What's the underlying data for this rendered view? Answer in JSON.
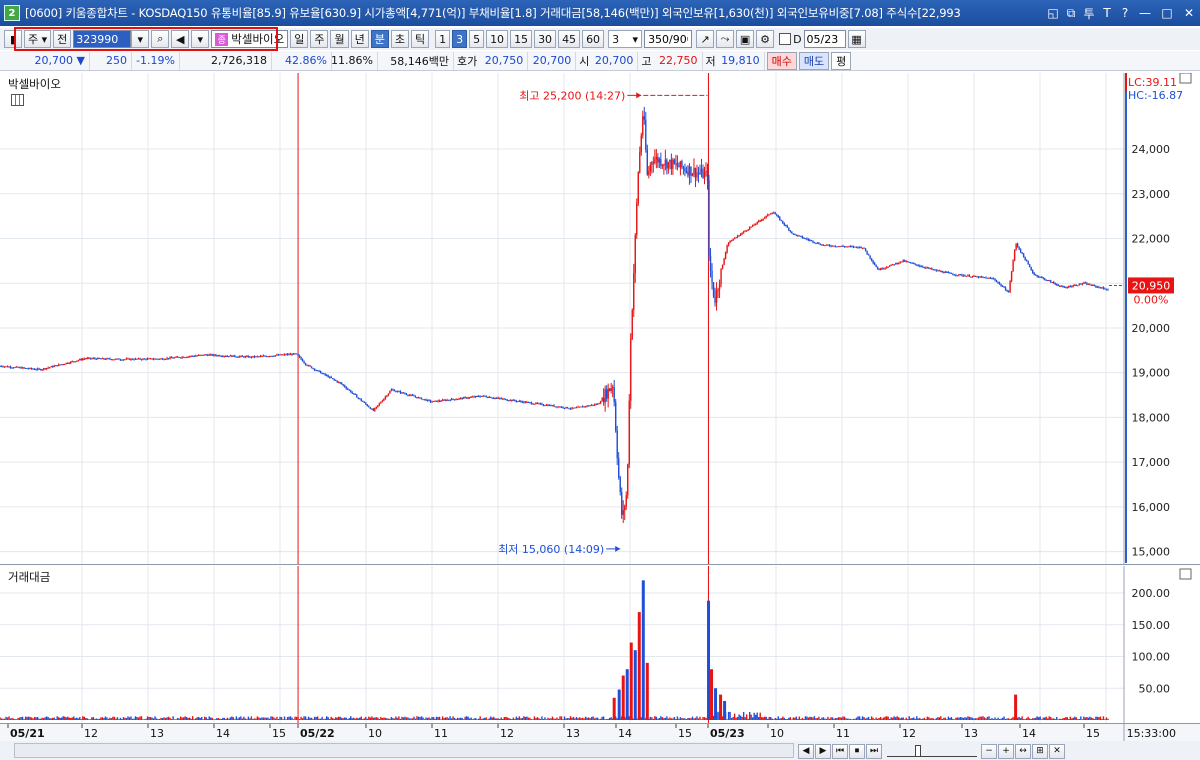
{
  "title_bar": {
    "badge": "2",
    "text": "[0600] 키움종합차트 - KOSDAQ150 유통비율[85.9] 유보율[630.9] 시가총액[4,771(억)] 부채비율[1.8] 거래대금[58,146(백만)] 외국인보유[1,630(천)] 외국인보유비중[7.08] 주식수[22,993",
    "controls": [
      "◱",
      "⧉",
      "투",
      "T",
      "?",
      "—",
      "□",
      "✕"
    ]
  },
  "toolbar": {
    "type_label": "주",
    "prev_label": "전",
    "stock_code": "323990",
    "stock_name": "박셀바이오",
    "stock_badge": "종",
    "periods": [
      "일",
      "주",
      "월",
      "년",
      "분",
      "초",
      "틱"
    ],
    "selected_period": "분",
    "intervals": [
      "1",
      "3",
      "5",
      "10",
      "15",
      "30",
      "45",
      "60"
    ],
    "selected_interval": "3",
    "interval_select": "3",
    "count": "350/900",
    "checkbox_label": "D",
    "date": "05/23"
  },
  "quote": {
    "price": "20,700",
    "direction_icon": "down-triangle",
    "change": "250",
    "change_pct": "-1.19%",
    "volume": "2,726,318",
    "volume_ratio": "42.86%",
    "turnover_pct": "11.86%",
    "amount": "58,146백만",
    "bid_label": "호가",
    "bid_value": "20,750",
    "ask_value": "20,700",
    "open_label": "시",
    "open_value": "20,700",
    "high_label": "고",
    "high_value": "22,750",
    "low_label": "저",
    "low_value": "19,810",
    "buy_label": "매수",
    "sell_label": "매도",
    "flat_label": "평"
  },
  "price_pane": {
    "label": "박셀바이오",
    "lc": "LC:39.11",
    "hc": "HC:-16.87",
    "current_price": "20,950",
    "current_pct": "0.00%",
    "high_annotation": "최고 25,200 (14:27)",
    "low_annotation": "최저 15,060 (14:09)",
    "y_ticks": [
      "24,000",
      "23,000",
      "22,000",
      "21,000",
      "20,000",
      "19,000",
      "18,000",
      "17,000",
      "16,000",
      "15,000"
    ]
  },
  "volume_pane": {
    "label": "거래대금",
    "y_ticks": [
      "200.00",
      "150.00",
      "100.00",
      "50.00"
    ]
  },
  "x_axis": {
    "labels": [
      "05/21",
      "12",
      "13",
      "14",
      "15",
      "05/22",
      "10",
      "11",
      "12",
      "13",
      "14",
      "15",
      "05/23",
      "10",
      "11",
      "12",
      "13",
      "14",
      "15"
    ],
    "time": "15:33:00"
  },
  "bottom_controls": [
    "◀",
    "▶",
    "⏮",
    "⏹",
    "⏭",
    "−",
    "+",
    "↔",
    "⊞",
    "✕"
  ],
  "colors": {
    "up": "#e81414",
    "down": "#1f4fd8",
    "title_bar": "#1b4d9e",
    "highlight_frame": "#e01010",
    "axis_bar": "#2a5fc8"
  },
  "chart_data": {
    "type": "candlestick",
    "price_range": [
      14700,
      25700
    ],
    "volume_range": [
      0,
      230
    ],
    "x_range": [
      0,
      1120
    ],
    "volume_unit": "",
    "path": [
      [
        0,
        19150
      ],
      [
        40,
        19070
      ],
      [
        85,
        19320
      ],
      [
        120,
        19300
      ],
      [
        160,
        19310
      ],
      [
        205,
        19400
      ],
      [
        250,
        19350
      ],
      [
        295,
        19420
      ],
      [
        305,
        19180
      ],
      [
        340,
        18750
      ],
      [
        372,
        18150
      ],
      [
        390,
        18620
      ],
      [
        430,
        18350
      ],
      [
        480,
        18480
      ],
      [
        520,
        18350
      ],
      [
        570,
        18200
      ],
      [
        596,
        18300
      ],
      [
        611,
        18750
      ],
      [
        616,
        16800
      ],
      [
        620,
        15700
      ],
      [
        625,
        16400
      ],
      [
        628,
        19500
      ],
      [
        632,
        21500
      ],
      [
        636,
        23500
      ],
      [
        641,
        24900
      ],
      [
        645,
        23400
      ],
      [
        650,
        23800
      ],
      [
        705,
        23400
      ],
      [
        706,
        21600
      ],
      [
        712,
        20600
      ],
      [
        725,
        21900
      ],
      [
        770,
        22600
      ],
      [
        790,
        22100
      ],
      [
        820,
        21850
      ],
      [
        860,
        21800
      ],
      [
        875,
        21300
      ],
      [
        900,
        21500
      ],
      [
        930,
        21300
      ],
      [
        950,
        21200
      ],
      [
        990,
        21100
      ],
      [
        1005,
        20800
      ],
      [
        1012,
        21900
      ],
      [
        1030,
        21200
      ],
      [
        1060,
        20900
      ],
      [
        1080,
        21000
      ],
      [
        1105,
        20850
      ]
    ],
    "volume_spikes": [
      [
        612,
        35
      ],
      [
        617,
        48
      ],
      [
        621,
        70
      ],
      [
        625,
        80
      ],
      [
        629,
        122
      ],
      [
        633,
        110
      ],
      [
        637,
        170
      ],
      [
        641,
        220
      ],
      [
        645,
        90
      ],
      [
        706,
        188
      ],
      [
        709,
        80
      ],
      [
        713,
        50
      ],
      [
        718,
        40
      ],
      [
        722,
        30
      ],
      [
        1012,
        40
      ]
    ],
    "annotations": [
      {
        "text": "최고 25,200 (14:27)",
        "x": 641,
        "y": 25200
      },
      {
        "text": "최저 15,060 (14:09)",
        "x": 620,
        "y": 15060
      }
    ],
    "session_dividers": [
      297,
      706
    ]
  }
}
